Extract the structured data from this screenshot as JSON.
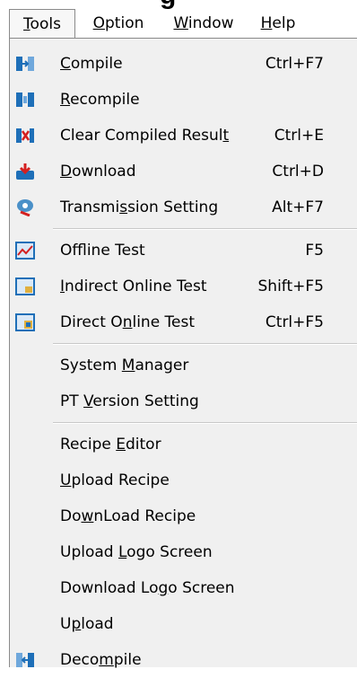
{
  "heading_fragment": "g",
  "menubar": {
    "items": [
      {
        "label": "Tools",
        "accel": "T",
        "pre": "",
        "post": "ools"
      },
      {
        "label": "Option",
        "accel": "O",
        "pre": "",
        "post": "ption"
      },
      {
        "label": "Window",
        "accel": "W",
        "pre": "",
        "post": "indow"
      },
      {
        "label": "Help",
        "accel": "H",
        "pre": "",
        "post": "elp"
      }
    ]
  },
  "tools_menu": {
    "items": [
      {
        "pre": "",
        "accel": "C",
        "post": "ompile",
        "shortcut": "Ctrl+F7",
        "icon": "compile-icon"
      },
      {
        "pre": "",
        "accel": "R",
        "post": "ecompile",
        "shortcut": "",
        "icon": "recompile-icon"
      },
      {
        "pre": "Clear Compiled Resul",
        "accel": "t",
        "post": "",
        "shortcut": "Ctrl+E",
        "icon": "clear-compiled-icon"
      },
      {
        "pre": "",
        "accel": "D",
        "post": "ownload",
        "shortcut": "Ctrl+D",
        "icon": "download-icon"
      },
      {
        "pre": "Transmi",
        "accel": "s",
        "post": "sion Setting",
        "shortcut": "Alt+F7",
        "icon": "transmission-icon"
      },
      {
        "pre": "Offline Test",
        "accel": "",
        "post": "",
        "shortcut": "F5",
        "icon": "offline-test-icon"
      },
      {
        "pre": "",
        "accel": "I",
        "post": "ndirect Online Test",
        "shortcut": "Shift+F5",
        "icon": "indirect-online-test-icon"
      },
      {
        "pre": "Direct O",
        "accel": "n",
        "post": "line Test",
        "shortcut": "Ctrl+F5",
        "icon": "direct-online-test-icon"
      },
      {
        "pre": "System ",
        "accel": "M",
        "post": "anager",
        "shortcut": "",
        "icon": ""
      },
      {
        "pre": "PT ",
        "accel": "V",
        "post": "ersion Setting",
        "shortcut": "",
        "icon": ""
      },
      {
        "pre": "Recipe ",
        "accel": "E",
        "post": "ditor",
        "shortcut": "",
        "icon": ""
      },
      {
        "pre": "",
        "accel": "U",
        "post": "pload Recipe",
        "shortcut": "",
        "icon": ""
      },
      {
        "pre": "Do",
        "accel": "w",
        "post": "nLoad Recipe",
        "shortcut": "",
        "icon": ""
      },
      {
        "pre": "Upload ",
        "accel": "L",
        "post": "ogo Screen",
        "shortcut": "",
        "icon": ""
      },
      {
        "pre": "Download Lo",
        "accel": "g",
        "post": "o Screen",
        "shortcut": "",
        "icon": ""
      },
      {
        "pre": "U",
        "accel": "p",
        "post": "load",
        "shortcut": "",
        "icon": ""
      },
      {
        "pre": "Deco",
        "accel": "m",
        "post": "pile",
        "shortcut": "",
        "icon": "decompile-icon"
      }
    ]
  },
  "colors": {
    "menu_bg": "#f0f0f0",
    "icon_blue": "#1e6fb8",
    "icon_red": "#d42020"
  }
}
